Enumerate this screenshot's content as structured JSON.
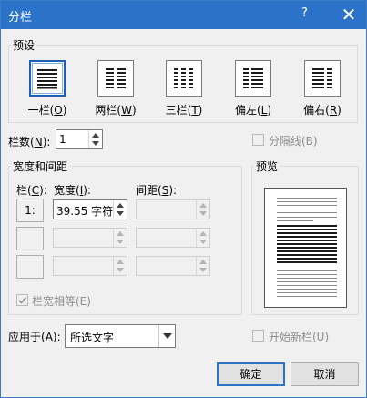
{
  "window": {
    "title": "分栏",
    "help": "?",
    "close": "✕"
  },
  "presets": {
    "group": "预设",
    "items": [
      {
        "label": "一栏",
        "key": "O",
        "icon": "one-column-icon",
        "selected": true
      },
      {
        "label": "两栏",
        "key": "W",
        "icon": "two-columns-icon",
        "selected": false
      },
      {
        "label": "三栏",
        "key": "T",
        "icon": "three-columns-icon",
        "selected": false
      },
      {
        "label": "偏左",
        "key": "L",
        "icon": "left-column-icon",
        "selected": false
      },
      {
        "label": "偏右",
        "key": "R",
        "icon": "right-column-icon",
        "selected": false
      }
    ]
  },
  "columns": {
    "label": "栏数",
    "key": "N",
    "value": "1"
  },
  "separator": {
    "label": "分隔线(B)",
    "checked": false,
    "enabled": false
  },
  "width_spacing": {
    "group": "宽度和间距",
    "col_header": "栏",
    "col_key": "C",
    "width_header": "宽度",
    "width_key": "I",
    "spacing_header": "间距",
    "spacing_key": "S",
    "rows": [
      {
        "col": "1:",
        "width": "39.55 字符",
        "spacing": ""
      },
      {
        "col": "",
        "width": "",
        "spacing": ""
      },
      {
        "col": "",
        "width": "",
        "spacing": ""
      }
    ],
    "equal": {
      "label": "栏宽相等(E)",
      "checked": true,
      "enabled": false
    }
  },
  "preview": {
    "group": "预览"
  },
  "apply": {
    "label": "应用于",
    "key": "A",
    "value": "所选文字"
  },
  "new_column": {
    "label": "开始新栏(U)",
    "checked": false,
    "enabled": false
  },
  "buttons": {
    "ok": "确定",
    "cancel": "取消"
  }
}
